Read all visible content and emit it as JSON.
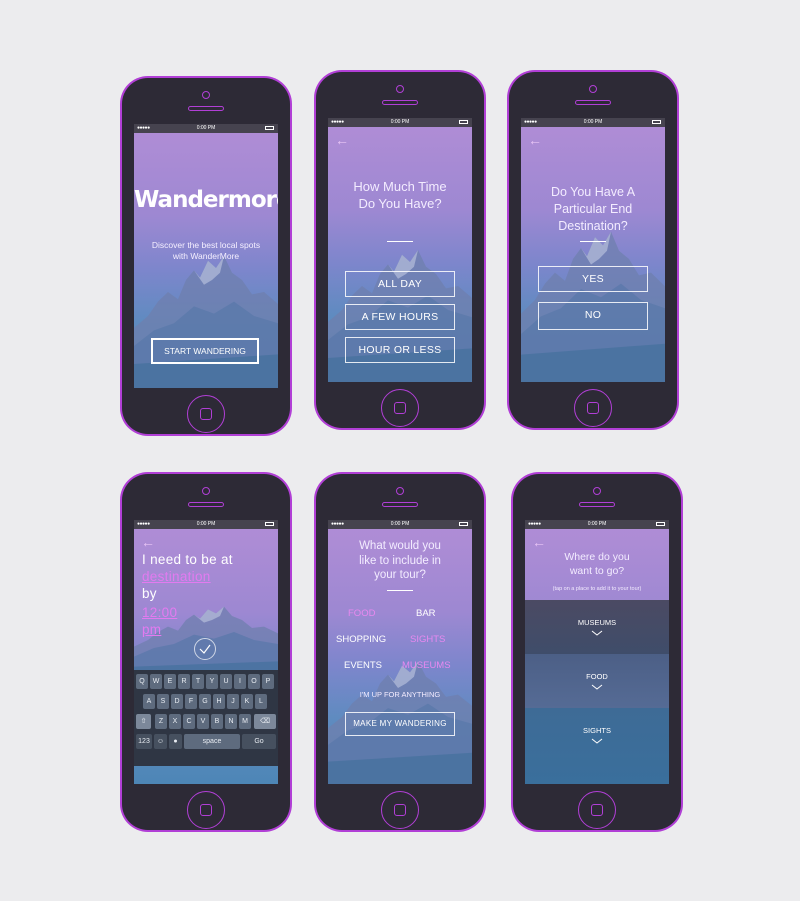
{
  "status": {
    "time": "0:00 PM"
  },
  "s1": {
    "logo": "Wandermore",
    "tagline": "Discover the best local spots with WanderMore",
    "start_button": "START WANDERING"
  },
  "s2": {
    "back_icon": "back-arrow-icon",
    "question": "How Much Time Do You Have?",
    "options": [
      "ALL DAY",
      "A FEW HOURS",
      "HOUR OR LESS"
    ]
  },
  "s3": {
    "back_icon": "back-arrow-icon",
    "question": "Do You Have A Particular End Destination?",
    "options": [
      "YES",
      "NO"
    ]
  },
  "s4": {
    "back_icon": "back-arrow-icon",
    "line1": "I need to be at",
    "destination": "destination",
    "by": "by",
    "time": "12:00 pm",
    "keyboard": {
      "row1": [
        "Q",
        "W",
        "E",
        "R",
        "T",
        "Y",
        "U",
        "I",
        "O",
        "P"
      ],
      "row2": [
        "A",
        "S",
        "D",
        "F",
        "G",
        "H",
        "J",
        "K",
        "L"
      ],
      "row3": [
        "Z",
        "X",
        "C",
        "V",
        "B",
        "N",
        "M"
      ],
      "num": "123",
      "space": "space",
      "go": "Go"
    }
  },
  "s5": {
    "question": "What would you like to include in your tour?",
    "tags": [
      {
        "label": "FOOD",
        "selected": true
      },
      {
        "label": "BAR",
        "selected": false
      },
      {
        "label": "SHOPPING",
        "selected": false
      },
      {
        "label": "SIGHTS",
        "selected": true
      },
      {
        "label": "EVENTS",
        "selected": false
      },
      {
        "label": "MUSEUMS",
        "selected": true
      }
    ],
    "anything": "I'M UP FOR ANYTHING",
    "make_button": "MAKE MY WANDERING"
  },
  "s6": {
    "back_icon": "back-arrow-icon",
    "question": "Where do you want to go?",
    "hint": "(tap on a place to add it to your tour)",
    "places": [
      "MUSEUMS",
      "FOOD",
      "SIGHTS"
    ]
  },
  "colors": {
    "frame": "#2d2a36",
    "accent": "#b13fd6",
    "highlight": "#e37af0"
  }
}
